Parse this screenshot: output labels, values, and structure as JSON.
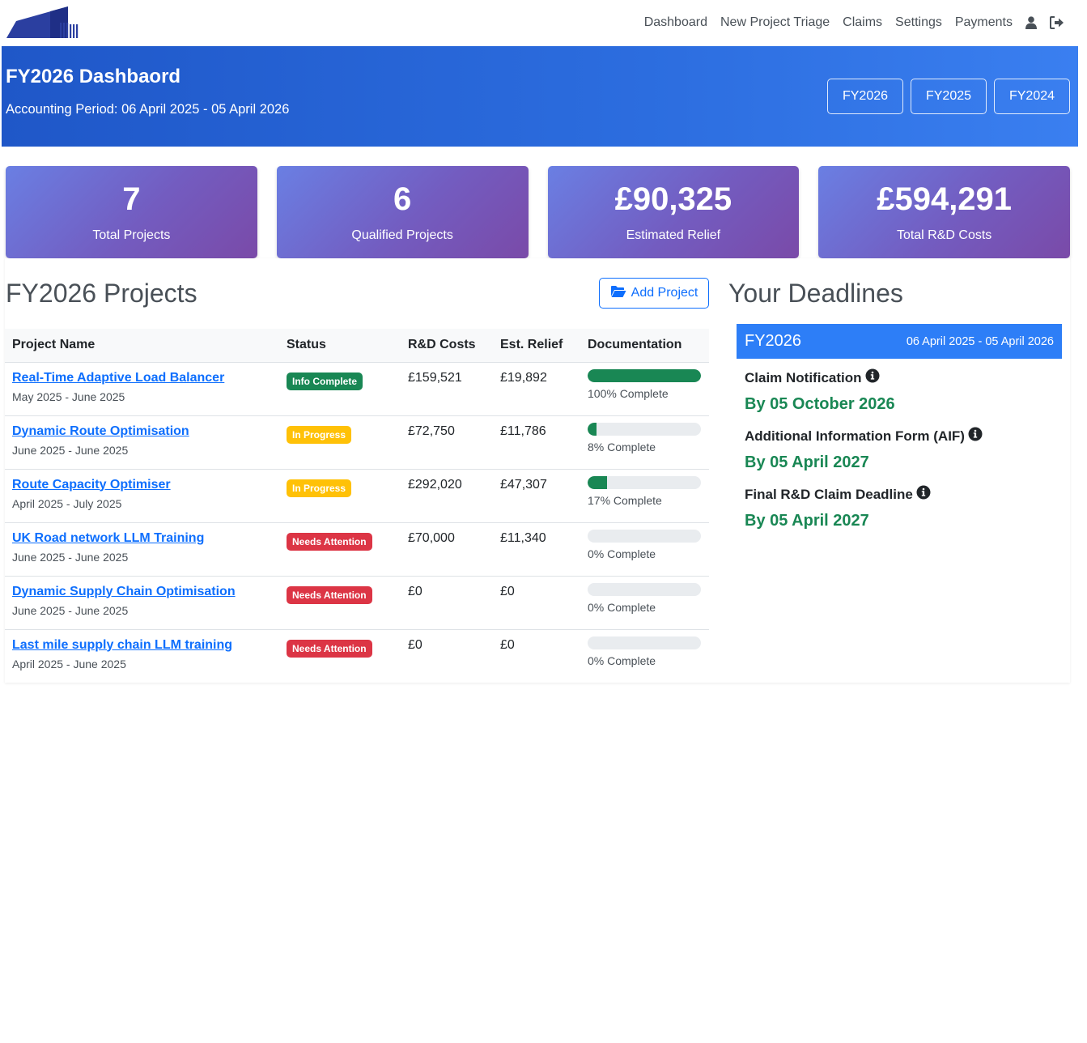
{
  "nav": {
    "links": [
      "Dashboard",
      "New Project Triage",
      "Claims",
      "Settings",
      "Payments"
    ],
    "user_icon": "user-icon",
    "logout_icon": "logout-icon"
  },
  "header": {
    "title": "FY2026 Dashbaord",
    "period": "Accounting Period: 06 April 2025 - 05 April 2026",
    "fy_buttons": [
      "FY2026",
      "FY2025",
      "FY2024"
    ]
  },
  "stats": [
    {
      "value": "7",
      "label": "Total Projects"
    },
    {
      "value": "6",
      "label": "Qualified Projects"
    },
    {
      "value": "£90,325",
      "label": "Estimated Relief"
    },
    {
      "value": "£594,291",
      "label": "Total R&D Costs"
    }
  ],
  "projects": {
    "title": "FY2026 Projects",
    "add_label": "Add Project",
    "columns": [
      "Project Name",
      "Status",
      "R&D Costs",
      "Est. Relief",
      "Documentation"
    ],
    "rows": [
      {
        "name": "Real-Time Adaptive Load Balancer",
        "dates": "May 2025 - June 2025",
        "status": "Info Complete",
        "status_color": "green",
        "costs": "£159,521",
        "relief": "£19,892",
        "progress": 100,
        "progress_text": "100% Complete"
      },
      {
        "name": "Dynamic Route Optimisation",
        "dates": "June 2025 - June 2025",
        "status": "In Progress",
        "status_color": "yellow",
        "costs": "£72,750",
        "relief": "£11,786",
        "progress": 8,
        "progress_text": "8% Complete"
      },
      {
        "name": "Route Capacity Optimiser",
        "dates": "April 2025 - July 2025",
        "status": "In Progress",
        "status_color": "yellow",
        "costs": "£292,020",
        "relief": "£47,307",
        "progress": 17,
        "progress_text": "17% Complete"
      },
      {
        "name": "UK Road network LLM Training",
        "dates": "June 2025 - June 2025",
        "status": "Needs Attention",
        "status_color": "red",
        "costs": "£70,000",
        "relief": "£11,340",
        "progress": 0,
        "progress_text": "0% Complete"
      },
      {
        "name": "Dynamic Supply Chain Optimisation",
        "dates": "June 2025 - June 2025",
        "status": "Needs Attention",
        "status_color": "red",
        "costs": "£0",
        "relief": "£0",
        "progress": 0,
        "progress_text": "0% Complete"
      },
      {
        "name": "Last mile supply chain LLM training",
        "dates": "April 2025 - June 2025",
        "status": "Needs Attention",
        "status_color": "red",
        "costs": "£0",
        "relief": "£0",
        "progress": 0,
        "progress_text": "0% Complete"
      }
    ]
  },
  "deadlines": {
    "title": "Your Deadlines",
    "fy": "FY2026",
    "range": "06 April 2025 - 05 April 2026",
    "items": [
      {
        "name": "Claim Notification",
        "date": "By 05 October 2026"
      },
      {
        "name": "Additional Information Form (AIF)",
        "date": "By 05 April 2027"
      },
      {
        "name": "Final R&D Claim Deadline",
        "date": "By 05 April 2027"
      }
    ]
  },
  "colors": {
    "brand_blue": "#2c6ddf",
    "link_blue": "#0d6efd",
    "success": "#198754",
    "warning": "#ffc107",
    "danger": "#dc3545",
    "stat_purple": "#735cc0"
  }
}
